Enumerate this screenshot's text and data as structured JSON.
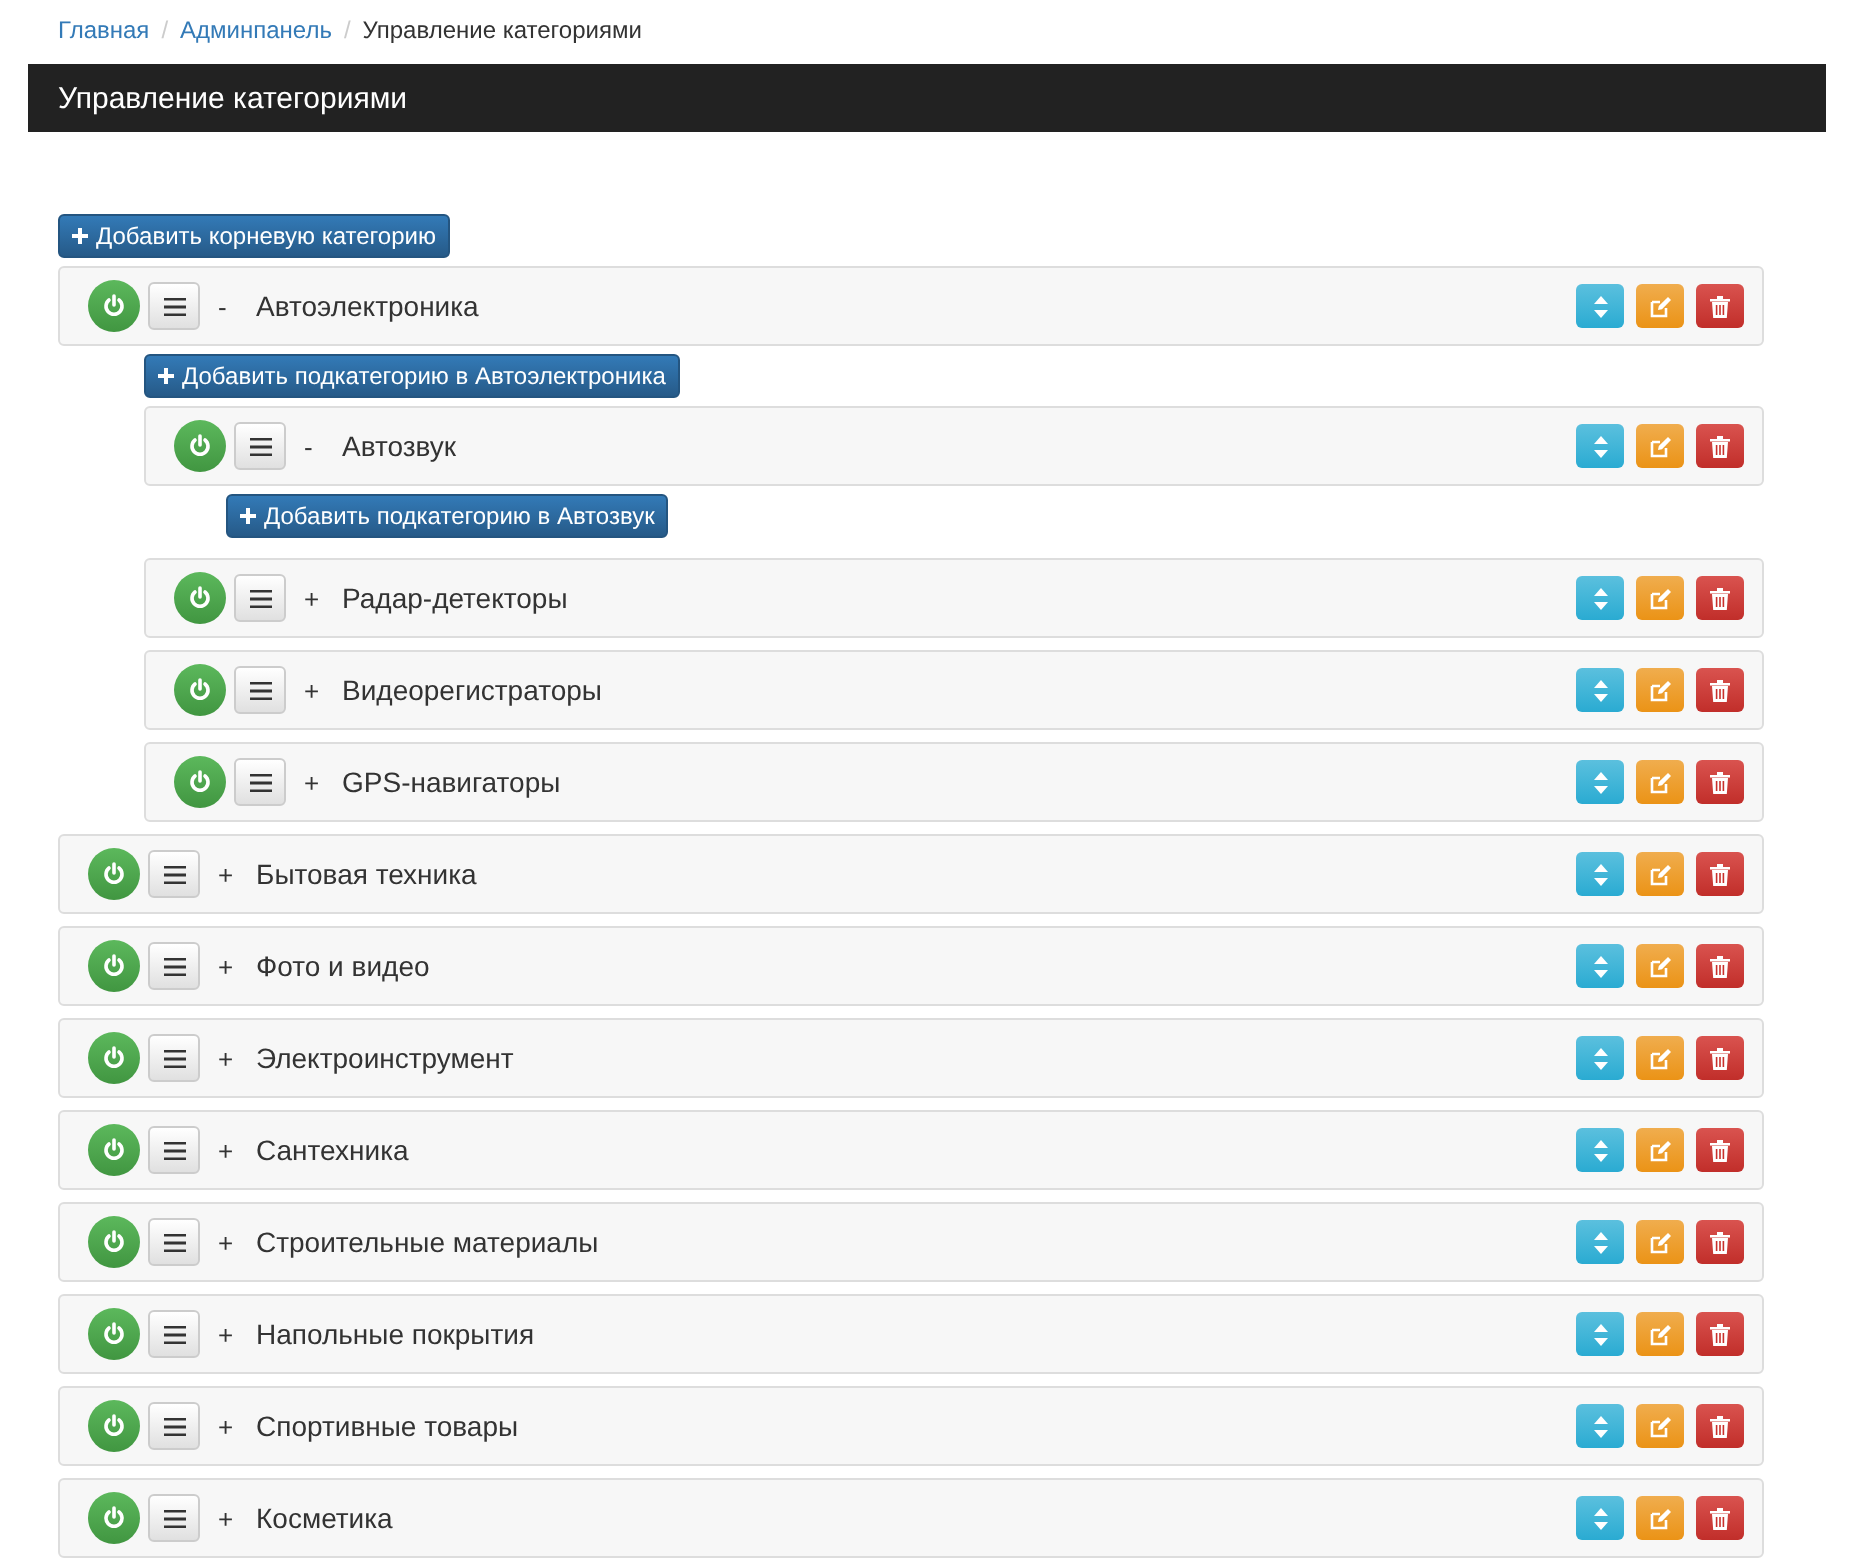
{
  "breadcrumb": [
    {
      "label": "Главная",
      "link": true
    },
    {
      "separator": "/",
      "label": "Админпанель",
      "link": true
    },
    {
      "separator": "/",
      "label": "Управление категориями",
      "link": false
    }
  ],
  "header": {
    "title": "Управление категориями"
  },
  "add_root_button": {
    "label": "Добавить корневую категорию"
  },
  "categories": [
    {
      "name": "Автоэлектроника",
      "toggle": "-",
      "enabled": true,
      "add_button": "Добавить подкатегорию в Автоэлектроника",
      "children": [
        {
          "name": "Автозвук",
          "toggle": "-",
          "enabled": true,
          "add_button": "Добавить подкатегорию в Автозвук"
        },
        {
          "name": "Радар-детекторы",
          "toggle": "+",
          "enabled": true
        },
        {
          "name": "Видеорегистраторы",
          "toggle": "+",
          "enabled": true
        },
        {
          "name": "GPS-навигаторы",
          "toggle": "+",
          "enabled": true
        }
      ]
    },
    {
      "name": "Бытовая техника",
      "toggle": "+",
      "enabled": true
    },
    {
      "name": "Фото и видео",
      "toggle": "+",
      "enabled": true
    },
    {
      "name": "Электроинструмент",
      "toggle": "+",
      "enabled": true
    },
    {
      "name": "Сантехника",
      "toggle": "+",
      "enabled": true
    },
    {
      "name": "Строительные материалы",
      "toggle": "+",
      "enabled": true
    },
    {
      "name": "Напольные покрытия",
      "toggle": "+",
      "enabled": true
    },
    {
      "name": "Спортивные товары",
      "toggle": "+",
      "enabled": true
    },
    {
      "name": "Косметика",
      "toggle": "+",
      "enabled": true
    }
  ]
}
